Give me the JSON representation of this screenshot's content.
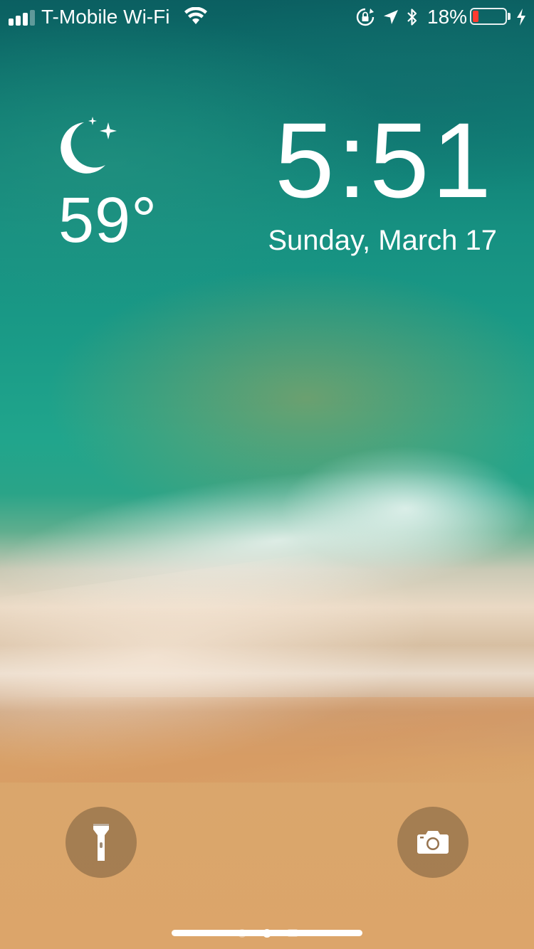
{
  "status_bar": {
    "carrier": "T-Mobile Wi-Fi",
    "battery_percent": "18%",
    "battery_level": 0.18,
    "battery_color": "#ff3b30",
    "signal_bars_filled": 3,
    "icons": [
      "signal-icon",
      "wifi-icon",
      "rotation-lock-icon",
      "location-arrow-icon",
      "bluetooth-icon",
      "battery-icon",
      "charging-bolt-icon"
    ]
  },
  "weather": {
    "icon": "moon-stars-icon",
    "temperature": "59°"
  },
  "lock_screen": {
    "time": "5:51",
    "date": "Sunday, March 17"
  },
  "quick_actions": {
    "flashlight_icon": "flashlight-icon",
    "camera_icon": "camera-icon"
  },
  "pager": {
    "page_count": 3,
    "current_page": 2
  }
}
